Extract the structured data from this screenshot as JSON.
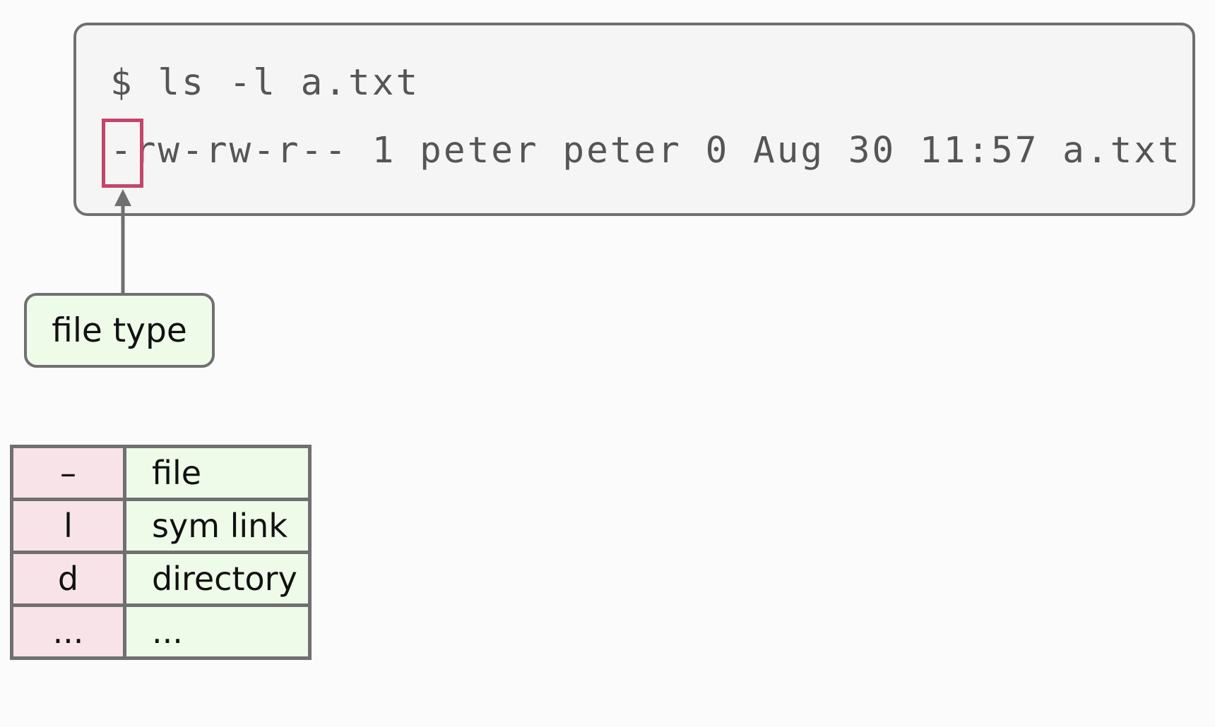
{
  "terminal": {
    "command": "$ ls -l a.txt",
    "output": "-rw-rw-r-- 1 peter peter 0 Aug 30 11:57 a.txt"
  },
  "callout": {
    "label": "file type"
  },
  "legend": {
    "rows": [
      {
        "symbol": "–",
        "meaning": "file"
      },
      {
        "symbol": "l",
        "meaning": "sym link"
      },
      {
        "symbol": "d",
        "meaning": "directory"
      },
      {
        "symbol": "...",
        "meaning": "..."
      }
    ]
  },
  "colors": {
    "highlight": "#c4456b",
    "border": "#707070",
    "callout_bg": "#eefbe9",
    "symbol_bg": "#f8e3e8"
  }
}
